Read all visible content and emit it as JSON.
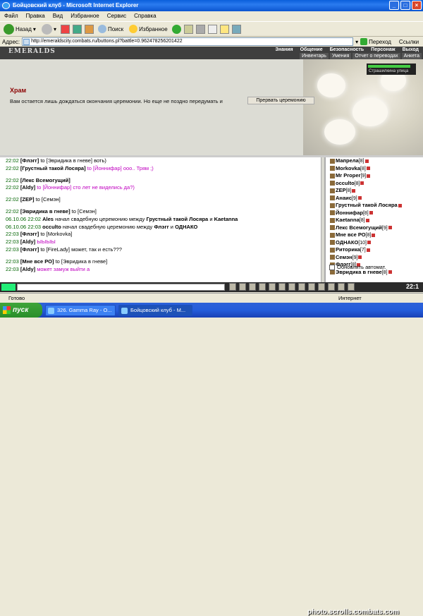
{
  "window": {
    "title": "Бойцовский клуб - Microsoft Internet Explorer"
  },
  "menu": [
    "Файл",
    "Правка",
    "Вид",
    "Избранное",
    "Сервис",
    "Справка"
  ],
  "toolbar": {
    "back": "Назад",
    "search": "Поиск",
    "favorites": "Избранное"
  },
  "address": {
    "label": "Адрес:",
    "url": "http://emeraldscity.combats.ru/buttons.pl?battle=0.962478256201422",
    "go": "Переход",
    "links": "Ссылки"
  },
  "site": {
    "logo": "EMERALDS",
    "nav_top": [
      "Знания",
      "Общение",
      "Безопасность",
      "Персонаж",
      "Выход"
    ],
    "nav_sub": [
      "Инвентарь",
      "Умения",
      "Отчет о переводах",
      "Анкета"
    ],
    "location": "Страшилкина улица",
    "temple_title": "Храм",
    "temple_text": "Вам остается лишь дождаться окончания церемонии. Но еще не поздно передумать и",
    "interrupt_button": "Прервать церемонию"
  },
  "chat": [
    {
      "time": "22:02",
      "parts": [
        {
          "c": "nick",
          "t": "[Флэгг]"
        },
        {
          "c": "",
          "t": " to [Эвридика в гневе] "
        },
        {
          "c": "",
          "t": "воть)"
        }
      ]
    },
    {
      "time": "22:02",
      "parts": [
        {
          "c": "nick",
          "t": "[Грустный такой Лосяра]"
        },
        {
          "c": "pink",
          "t": " to [Йоннифар] ооо.. Трям ;)"
        }
      ]
    },
    {
      "time": "",
      "parts": []
    },
    {
      "time": "22:02",
      "parts": [
        {
          "c": "nick",
          "t": "[Лекс Всемогущий]"
        }
      ]
    },
    {
      "time": "22:02",
      "parts": [
        {
          "c": "nick",
          "t": "[Aldy]"
        },
        {
          "c": "pink",
          "t": " to [Йоннифар] сто лет не виделись да?)"
        }
      ]
    },
    {
      "time": "",
      "parts": []
    },
    {
      "time": "22:02",
      "parts": [
        {
          "c": "nick",
          "t": "[ZEP]"
        },
        {
          "c": "",
          "t": " to [Семэн]"
        }
      ]
    },
    {
      "time": "",
      "parts": []
    },
    {
      "time": "22:02",
      "parts": [
        {
          "c": "nick",
          "t": "[Эвридика в гневе]"
        },
        {
          "c": "",
          "t": " to [Семэн]"
        }
      ]
    },
    {
      "time": "06.10.06 22:02",
      "parts": [
        {
          "c": "nick",
          "t": "Ales"
        },
        {
          "c": "",
          "t": " начал свадебную церемонию между "
        },
        {
          "c": "nick",
          "t": "Грустный такой Лосяра"
        },
        {
          "c": "",
          "t": " и "
        },
        {
          "c": "nick",
          "t": "Kaetanna"
        }
      ]
    },
    {
      "time": "06.10.06 22:03",
      "parts": [
        {
          "c": "nick",
          "t": "occulto"
        },
        {
          "c": "",
          "t": " начал свадебную церемонию между "
        },
        {
          "c": "nick",
          "t": "Флэгг"
        },
        {
          "c": "",
          "t": " и "
        },
        {
          "c": "nick",
          "t": "ОДНАКО"
        }
      ]
    },
    {
      "time": "22:03",
      "parts": [
        {
          "c": "nick",
          "t": "[Флэгг]"
        },
        {
          "c": "",
          "t": " to [Morkovka]"
        }
      ]
    },
    {
      "time": "22:03",
      "parts": [
        {
          "c": "nick",
          "t": "[Aldy]"
        },
        {
          "c": "pink",
          "t": " ЫЫЫЫ"
        }
      ]
    },
    {
      "time": "22:03",
      "parts": [
        {
          "c": "nick",
          "t": "[Флэгг]"
        },
        {
          "c": "",
          "t": " to [FireLady] может, так и есть???"
        }
      ]
    },
    {
      "time": "",
      "parts": []
    },
    {
      "time": "22:03",
      "parts": [
        {
          "c": "nick",
          "t": "[Мне все РО]"
        },
        {
          "c": "",
          "t": " to [Эвридика в гневе]"
        }
      ]
    },
    {
      "time": "22:03",
      "parts": [
        {
          "c": "nick",
          "t": "[Aldy]"
        },
        {
          "c": "pink",
          "t": " может замуж выйти а"
        }
      ]
    }
  ],
  "users": [
    {
      "name": "Мапрела",
      "level": "[8]"
    },
    {
      "name": "Morkovka",
      "level": "[8]"
    },
    {
      "name": "Mr Proper",
      "level": "[9]"
    },
    {
      "name": "occulto",
      "level": "[8]"
    },
    {
      "name": "ZEP",
      "level": "[8]"
    },
    {
      "name": "Анаис",
      "level": "[9]"
    },
    {
      "name": "Грустный такой Лосяра",
      "level": ""
    },
    {
      "name": "Йоннифар",
      "level": "[8]"
    },
    {
      "name": "Kaetanna",
      "level": "[8]"
    },
    {
      "name": "Лекс Всемогущий",
      "level": "[9]"
    },
    {
      "name": "Мне все РО",
      "level": "[8]"
    },
    {
      "name": "ОДНАКО",
      "level": "[10]"
    },
    {
      "name": "Риторика",
      "level": "[7]"
    },
    {
      "name": "Семэн",
      "level": "[9]"
    },
    {
      "name": "Флэгг",
      "level": "[8]"
    },
    {
      "name": "Эвридика в гневе",
      "level": "[8]"
    }
  ],
  "auto_update": "Обновлять автомат.",
  "clock": "22:1",
  "status": {
    "left": "Готово",
    "right": "Интернет"
  },
  "taskbar": {
    "start": "пуск",
    "tasks": [
      "326. Gamma Ray - O...",
      "Бойцовский клуб - M..."
    ]
  },
  "watermark": "photo.scrolls.combats.com"
}
